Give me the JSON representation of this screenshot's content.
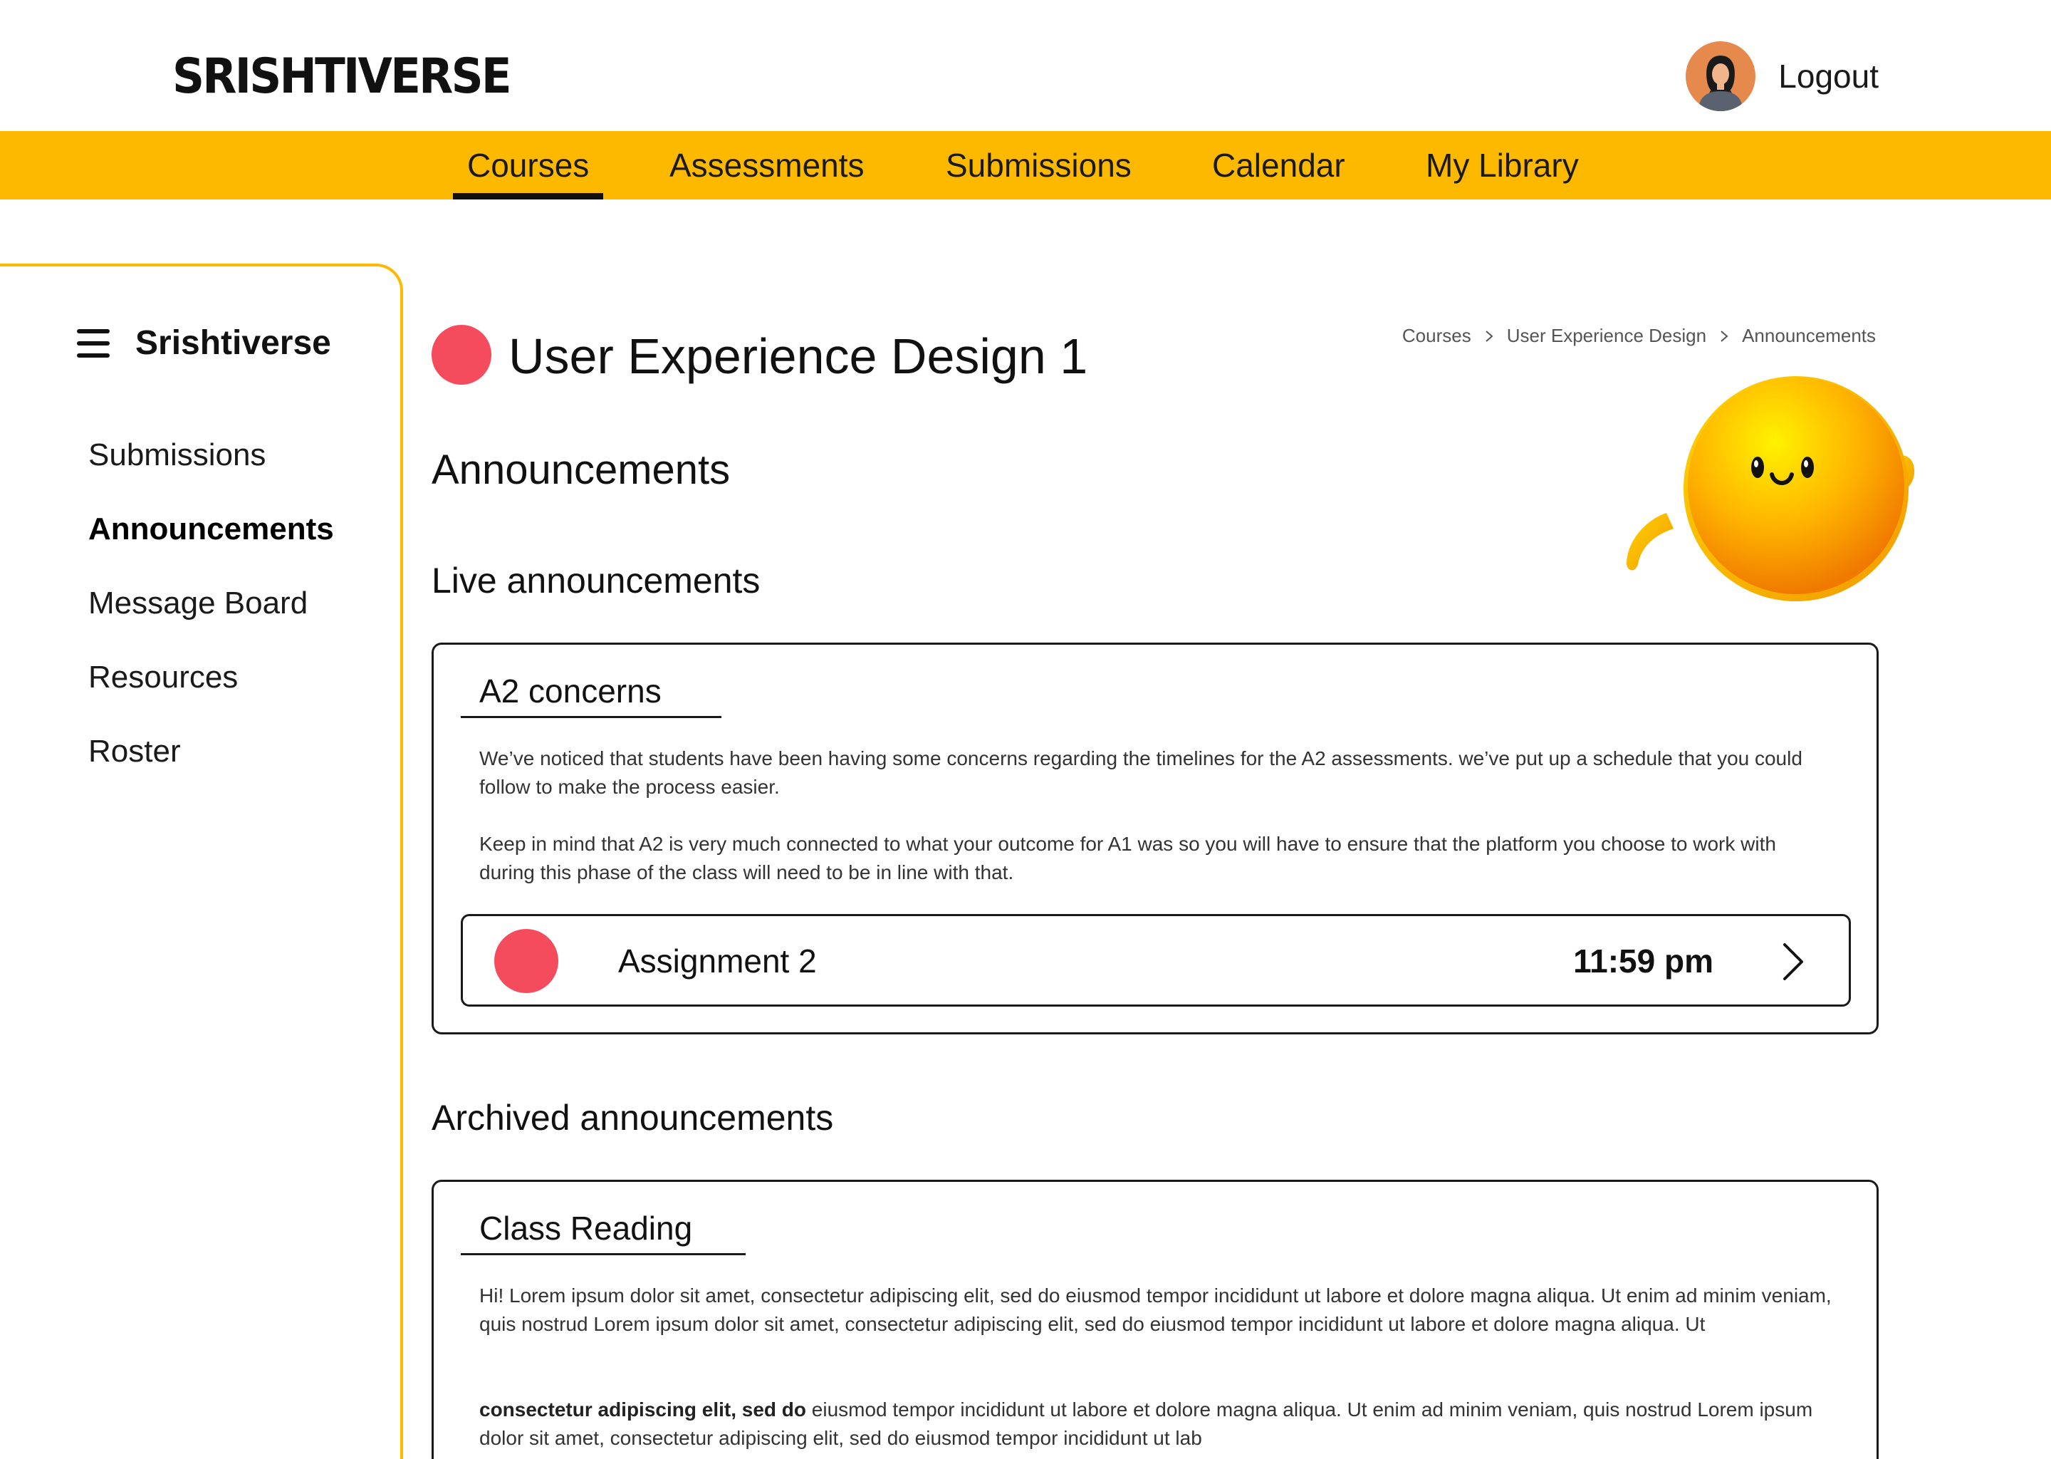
{
  "header": {
    "logo": "SRISHTIVERSE",
    "logout_label": "Logout",
    "avatar_icon": "user-avatar"
  },
  "nav": {
    "items": [
      {
        "label": "Courses",
        "active": true
      },
      {
        "label": "Assessments",
        "active": false
      },
      {
        "label": "Submissions",
        "active": false
      },
      {
        "label": "Calendar",
        "active": false
      },
      {
        "label": "My Library",
        "active": false
      }
    ]
  },
  "sidebar": {
    "title": "Srishtiverse",
    "menu_icon": "hamburger-icon",
    "items": [
      {
        "label": "Submissions",
        "active": false
      },
      {
        "label": "Announcements",
        "active": true
      },
      {
        "label": "Message Board",
        "active": false
      },
      {
        "label": "Resources",
        "active": false
      },
      {
        "label": "Roster",
        "active": false
      }
    ]
  },
  "course": {
    "title": "User Experience Design 1"
  },
  "breadcrumb": [
    "Courses",
    "User Experience Design",
    "Announcements"
  ],
  "page": {
    "heading": "Announcements",
    "live_heading": "Live announcements",
    "archived_heading": "Archived announcements"
  },
  "live_announcement": {
    "title": "A2 concerns",
    "paragraph_1": "We’ve noticed that students have been having some concerns regarding the timelines for the A2 assessments. we’ve put up a schedule that you could follow to make the process easier.",
    "paragraph_2": "Keep in mind that A2 is very much connected to what your outcome for A1 was so you will have to ensure that the platform you choose to work with during this phase of the class will need to be in line with that.",
    "assignment": {
      "label": "Assignment 2",
      "time": "11:59 pm"
    }
  },
  "archived_announcement": {
    "title": "Class Reading",
    "paragraph_1": "Hi! Lorem ipsum dolor sit amet, consectetur adipiscing elit, sed do eiusmod tempor incididunt ut labore et dolore magna aliqua. Ut enim ad minim veniam, quis nostrud Lorem ipsum dolor sit amet, consectetur adipiscing elit, sed do eiusmod tempor incididunt ut labore et dolore magna aliqua. Ut",
    "paragraph_2_bold": "consectetur adipiscing elit, sed do",
    "paragraph_2_rest": " eiusmod tempor incididunt ut labore et dolore magna aliqua. Ut enim ad minim veniam, quis nostrud Lorem ipsum dolor sit amet, consectetur adipiscing elit, sed do eiusmod tempor incididunt ut lab"
  },
  "colors": {
    "accent_yellow": "#FDB900",
    "course_red": "#F44C5D",
    "avatar_orange": "#E58A4C"
  }
}
